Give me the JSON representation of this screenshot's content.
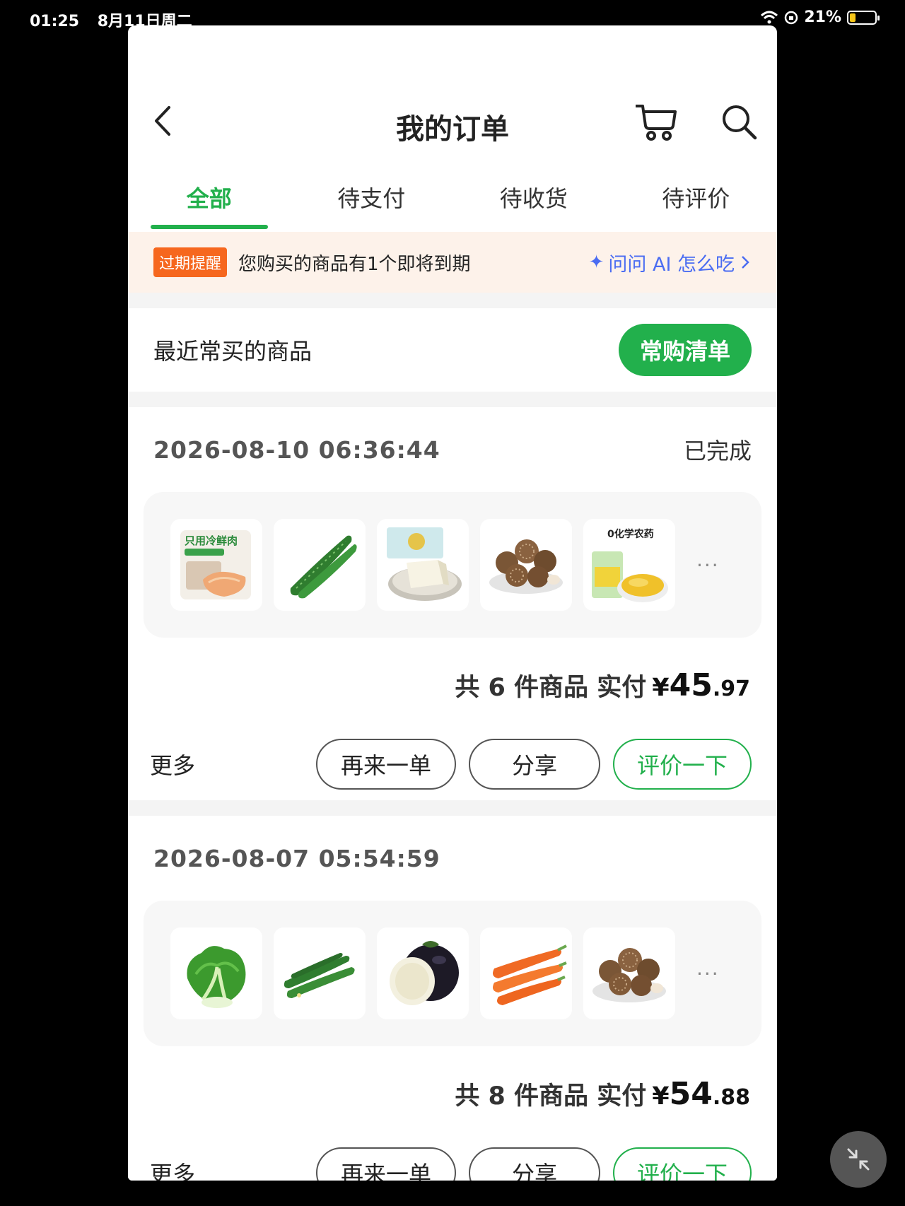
{
  "status_bar": {
    "time": "01:25",
    "date": "8月11日周二",
    "battery": "21%"
  },
  "header": {
    "title": "我的订单"
  },
  "tabs": [
    {
      "label": "全部",
      "active": true
    },
    {
      "label": "待支付"
    },
    {
      "label": "待收货"
    },
    {
      "label": "待评价"
    }
  ],
  "expiry": {
    "badge": "过期提醒",
    "text": "您购买的商品有1个即将到期",
    "ai_label": "问问 AI 怎么吃"
  },
  "frequent": {
    "label": "最近常买的商品",
    "button": "常购清单"
  },
  "orders": [
    {
      "date": "2026-08-10 06:36:44",
      "status": "已完成",
      "items_icons": [
        "pork-package-icon",
        "cucumber-icon",
        "tofu-icon",
        "shiitake-mushroom-icon",
        "corn-kernels-package-icon"
      ],
      "count_text": "共 6 件商品 实付",
      "price_symbol": "¥",
      "price_int": "45",
      "price_dec": ".97",
      "more_label": "更多",
      "reorder_label": "再来一单",
      "share_label": "分享",
      "review_label": "评价一下"
    },
    {
      "date": "2026-08-07 05:54:59",
      "status": "",
      "items_icons": [
        "bok-choy-icon",
        "cucumber-icon",
        "eggplant-icon",
        "carrot-icon",
        "shiitake-mushroom-icon"
      ],
      "count_text": "共 8 件商品 实付",
      "price_symbol": "¥",
      "price_int": "54",
      "price_dec": ".88",
      "more_label": "更多",
      "reorder_label": "再来一单",
      "share_label": "分享",
      "review_label": "评价一下"
    }
  ],
  "colors": {
    "accent": "#22b04c",
    "badge": "#f6671e",
    "ai": "#4a6cf2"
  }
}
